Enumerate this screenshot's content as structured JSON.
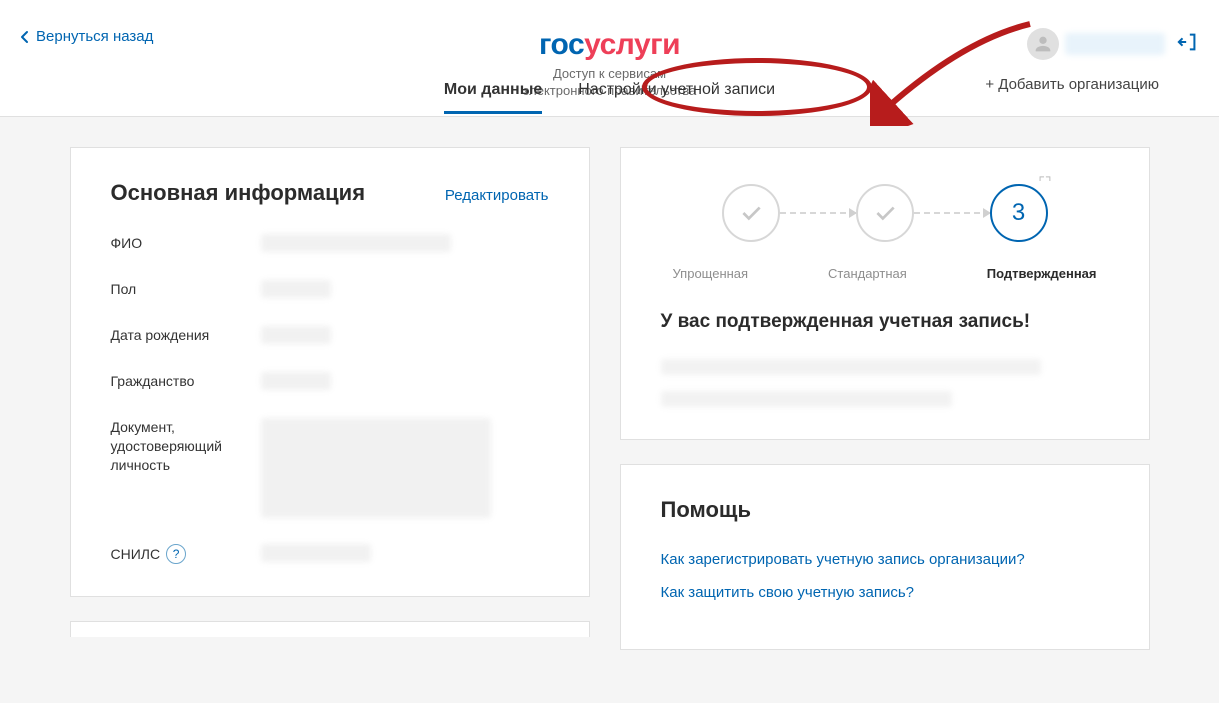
{
  "header": {
    "back_label": "Вернуться назад",
    "logo_part1": "гос",
    "logo_part2": "услуги",
    "subtitle_line1": "Доступ к сервисам",
    "subtitle_line2": "электронного правительства"
  },
  "tabs": {
    "my_data": "Мои данные",
    "settings": "Настройки учетной записи",
    "add_org": "+ Добавить организацию"
  },
  "main_info": {
    "title": "Основная информация",
    "edit_label": "Редактировать",
    "fields": {
      "fio": "ФИО",
      "gender": "Пол",
      "dob": "Дата рождения",
      "citizenship": "Гражданство",
      "id_doc": "Документ, удостоверяющий личность",
      "snils": "СНИЛС"
    },
    "help_icon_text": "?"
  },
  "status": {
    "step3": "3",
    "labels": {
      "simple": "Упрощенная",
      "standard": "Стандартная",
      "confirmed": "Подтвержденная"
    },
    "title": "У вас подтвержденная учетная запись!"
  },
  "help": {
    "title": "Помощь",
    "links": {
      "register_org": "Как зарегистрировать учетную запись организации?",
      "protect": "Как защитить свою учетную запись?"
    }
  }
}
